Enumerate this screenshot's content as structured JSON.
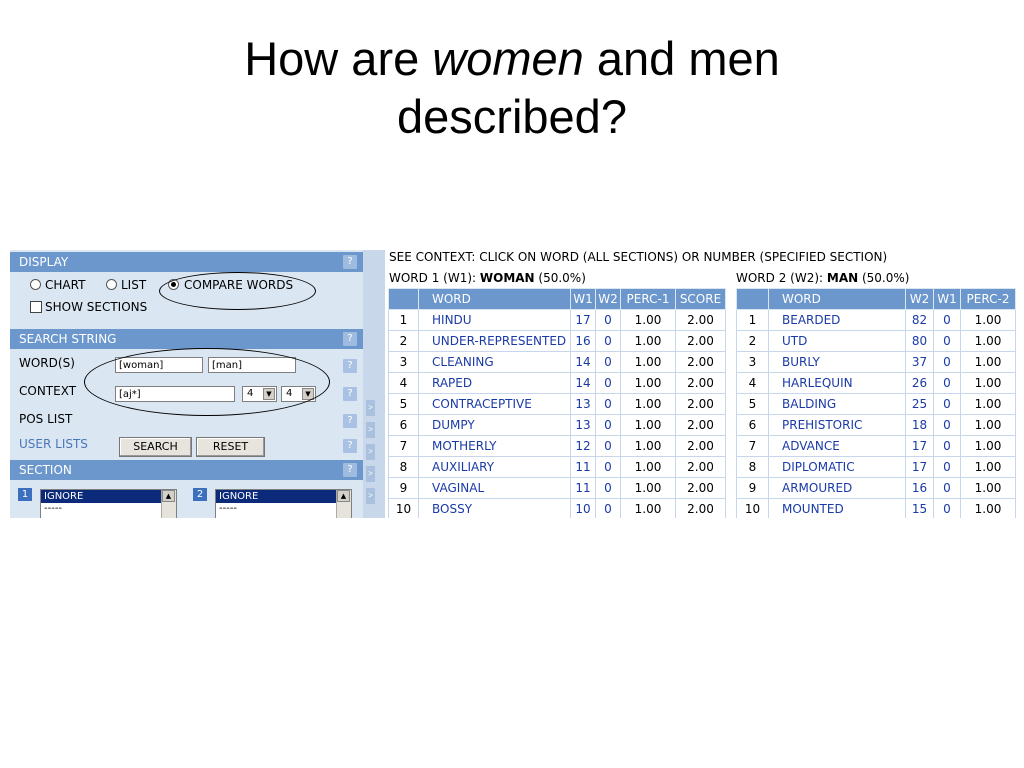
{
  "slide": {
    "title_part1": "How are ",
    "title_em": "women",
    "title_part2": " and men",
    "title_line2": "described?"
  },
  "left_panel": {
    "display": {
      "header": "DISPLAY",
      "help": "?",
      "radios": [
        {
          "label": "CHART",
          "selected": false
        },
        {
          "label": "LIST",
          "selected": false
        },
        {
          "label": "COMPARE WORDS",
          "selected": true
        }
      ],
      "show_sections_label": "SHOW SECTIONS",
      "show_sections_checked": false
    },
    "search_string": {
      "header": "SEARCH STRING",
      "help": "?",
      "words_label": "WORD(S)",
      "word1_value": "[woman]",
      "word2_value": "[man]",
      "context_label": "CONTEXT",
      "context_value": "[aj*]",
      "context_left": "4",
      "context_right": "4",
      "pos_list_label": "POS LIST",
      "user_lists_label": "USER LISTS",
      "search_button": "SEARCH",
      "reset_button": "RESET"
    },
    "section": {
      "header": "SECTION",
      "help": "?",
      "box1_number": "1",
      "box2_number": "2",
      "box1_items": [
        "IGNORE",
        "-----"
      ],
      "box2_items": [
        "IGNORE",
        "-----"
      ]
    }
  },
  "divider": {
    "tab_glyph": ">"
  },
  "results": {
    "header": "SEE CONTEXT: CLICK ON WORD (ALL SECTIONS) OR NUMBER (SPECIFIED SECTION)",
    "word1": {
      "prefix": "WORD 1 (W1): ",
      "word": "WOMAN",
      "suffix": " (50.0%)"
    },
    "word2": {
      "prefix": "WORD 2 (W2): ",
      "word": "MAN",
      "suffix": " (50.0%)"
    },
    "table1": {
      "columns": [
        "",
        "WORD",
        "W1",
        "W2",
        "PERC-1",
        "SCORE"
      ],
      "rows": [
        [
          "1",
          "HINDU",
          "17",
          "0",
          "1.00",
          "2.00"
        ],
        [
          "2",
          "UNDER-REPRESENTED",
          "16",
          "0",
          "1.00",
          "2.00"
        ],
        [
          "3",
          "CLEANING",
          "14",
          "0",
          "1.00",
          "2.00"
        ],
        [
          "4",
          "RAPED",
          "14",
          "0",
          "1.00",
          "2.00"
        ],
        [
          "5",
          "CONTRACEPTIVE",
          "13",
          "0",
          "1.00",
          "2.00"
        ],
        [
          "6",
          "DUMPY",
          "13",
          "0",
          "1.00",
          "2.00"
        ],
        [
          "7",
          "MOTHERLY",
          "12",
          "0",
          "1.00",
          "2.00"
        ],
        [
          "8",
          "AUXILIARY",
          "11",
          "0",
          "1.00",
          "2.00"
        ],
        [
          "9",
          "VAGINAL",
          "11",
          "0",
          "1.00",
          "2.00"
        ],
        [
          "10",
          "BOSSY",
          "10",
          "0",
          "1.00",
          "2.00"
        ]
      ]
    },
    "table2": {
      "columns": [
        "",
        "WORD",
        "W2",
        "W1",
        "PERC-2"
      ],
      "rows": [
        [
          "1",
          "BEARDED",
          "82",
          "0",
          "1.00"
        ],
        [
          "2",
          "UTD",
          "80",
          "0",
          "1.00"
        ],
        [
          "3",
          "BURLY",
          "37",
          "0",
          "1.00"
        ],
        [
          "4",
          "HARLEQUIN",
          "26",
          "0",
          "1.00"
        ],
        [
          "5",
          "BALDING",
          "25",
          "0",
          "1.00"
        ],
        [
          "6",
          "PREHISTORIC",
          "18",
          "0",
          "1.00"
        ],
        [
          "7",
          "ADVANCE",
          "17",
          "0",
          "1.00"
        ],
        [
          "8",
          "DIPLOMATIC",
          "17",
          "0",
          "1.00"
        ],
        [
          "9",
          "ARMOURED",
          "16",
          "0",
          "1.00"
        ],
        [
          "10",
          "MOUNTED",
          "15",
          "0",
          "1.00"
        ]
      ]
    }
  }
}
